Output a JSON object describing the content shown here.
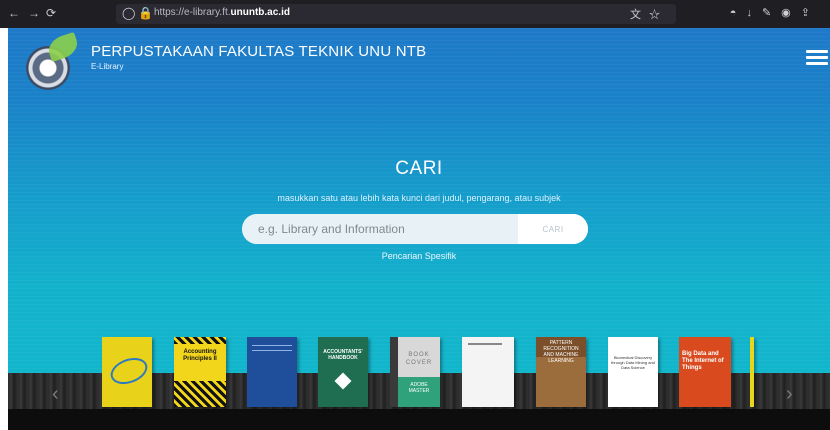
{
  "browser": {
    "nav_icons": [
      "back-icon",
      "forward-icon",
      "reload-icon"
    ],
    "url_prefix": "https://e-library.ft.",
    "url_host": "ununtb.ac.id",
    "url_icons": [
      "translate-icon",
      "star-icon"
    ],
    "tool_icons": [
      "pocket-icon",
      "download-icon",
      "extensions-icon",
      "account-icon",
      "share-icon"
    ]
  },
  "header": {
    "title": "PERPUSTAKAAN FAKULTAS TEKNIK UNU NTB",
    "subtitle": "E-Library"
  },
  "search": {
    "heading": "CARI",
    "description": "masukkan satu atau lebih kata kunci dari judul, pengarang, atau subjek",
    "placeholder": "e.g. Library and Information",
    "button_label": "CARI",
    "specific_link": "Pencarian Spesifik"
  },
  "books": [
    {
      "name": "book-yellow-textbook",
      "title": "",
      "color": "#e8d21a"
    },
    {
      "name": "book-accounting-principles",
      "title": "Accounting Principles II",
      "color": "#f2d61c"
    },
    {
      "name": "book-blue-handbook",
      "title": "",
      "color": "#1f4f9a"
    },
    {
      "name": "book-accountants-handbook",
      "title": "ACCOUNTANTS' HANDBOOK",
      "color": "#1f6e52"
    },
    {
      "name": "book-cover-placeholder",
      "title": "BOOK COVER",
      "subtitle": "ADOBE MASTER",
      "color": "#d8d8d8"
    },
    {
      "name": "book-white-paper",
      "title": "",
      "color": "#f4f4f4"
    },
    {
      "name": "book-pattern-recognition",
      "title": "PATTERN RECOGNITION AND MACHINE LEARNING",
      "color": "#9b6d3d"
    },
    {
      "name": "book-biomedical-discovery",
      "title": "Biomedical Discovery through Data Mining and Data Science",
      "color": "#ffffff"
    },
    {
      "name": "book-big-data-iot",
      "title": "Big Data and The Internet of Things",
      "color": "#d94b1f"
    },
    {
      "name": "book-yellow-spine",
      "title": "",
      "color": "#e6d71a"
    }
  ],
  "carousel": {
    "prev_icon": "chevron-left-icon",
    "next_icon": "chevron-right-icon"
  }
}
